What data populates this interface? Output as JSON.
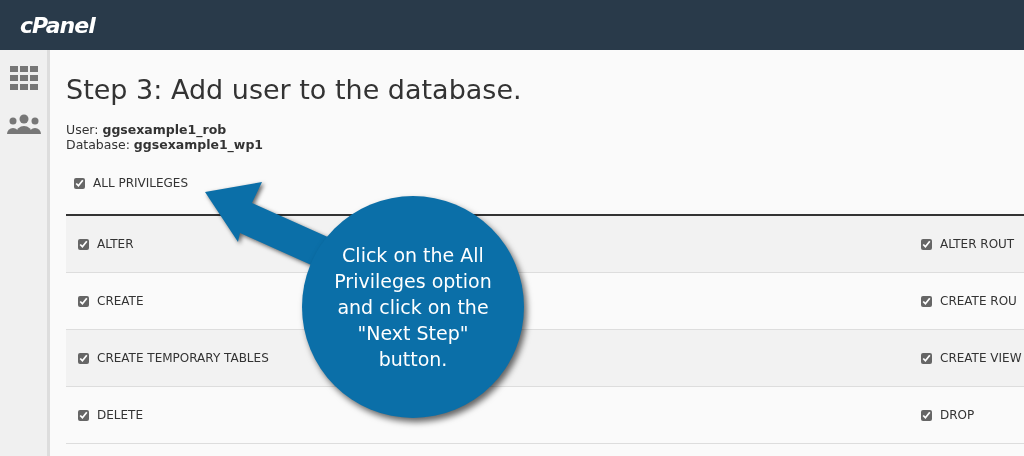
{
  "header": {
    "logo": "cPanel"
  },
  "page": {
    "title": "Step 3: Add user to the database.",
    "user_label": "User:",
    "user": "ggsexample1_rob",
    "database_label": "Database:",
    "database": "ggsexample1_wp1"
  },
  "all_privileges": {
    "label": "ALL PRIVILEGES",
    "checked": true
  },
  "privileges": [
    {
      "left": {
        "label": "ALTER",
        "checked": true
      },
      "right": {
        "label": "ALTER ROUT",
        "checked": true
      }
    },
    {
      "left": {
        "label": "CREATE",
        "checked": true
      },
      "right": {
        "label": "CREATE ROU",
        "checked": true
      }
    },
    {
      "left": {
        "label": "CREATE TEMPORARY TABLES",
        "checked": true
      },
      "right": {
        "label": "CREATE VIEW",
        "checked": true
      }
    },
    {
      "left": {
        "label": "DELETE",
        "checked": true
      },
      "right": {
        "label": "DROP",
        "checked": true
      }
    }
  ],
  "callout": {
    "text": "Click on the All Privileges option and click on the \"Next Step\" button."
  }
}
